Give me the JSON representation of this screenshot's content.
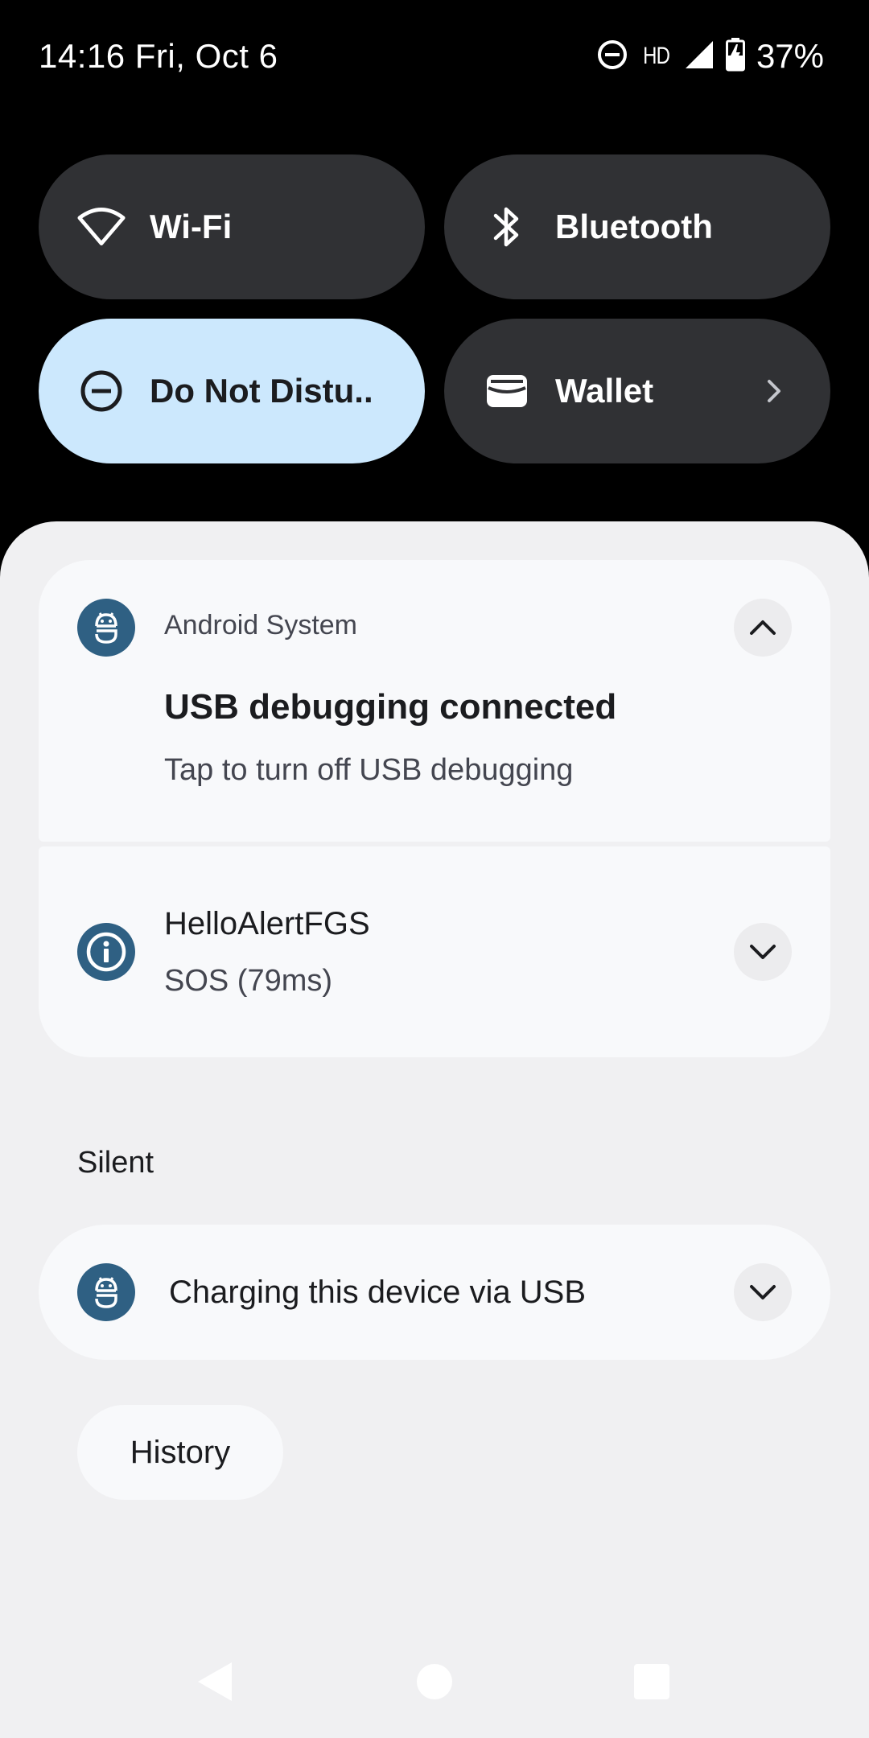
{
  "status_bar": {
    "time_date": "14:16 Fri, Oct 6",
    "network_label": "HD",
    "battery_percent": "37%",
    "icons": [
      "dnd-icon",
      "hd-icon",
      "signal-icon",
      "battery-charging-icon"
    ]
  },
  "quick_tiles": [
    {
      "label": "Wi-Fi",
      "icon": "wifi-icon",
      "active": false
    },
    {
      "label": "Bluetooth",
      "icon": "bluetooth-icon",
      "active": false
    },
    {
      "label": "Do Not Distu..",
      "icon": "dnd-icon",
      "active": true
    },
    {
      "label": "Wallet",
      "icon": "wallet-icon",
      "active": false,
      "has_chevron": true
    }
  ],
  "notifications": [
    {
      "app": "Android System",
      "title": "USB debugging connected",
      "text": "Tap to turn off USB debugging",
      "icon": "android-icon",
      "expanded": true
    },
    {
      "title": "HelloAlertFGS",
      "text": "SOS (79ms)",
      "icon": "info-icon",
      "expanded": false
    }
  ],
  "silent_section": {
    "label": "Silent",
    "notifications": [
      {
        "title": "Charging this device via USB",
        "icon": "android-icon",
        "expanded": false
      }
    ]
  },
  "history_label": "History",
  "colors": {
    "tile_bg": "#303134",
    "tile_active_bg": "#cce8fd",
    "shade_bg": "#f0f0f2",
    "card_bg": "#f8f9fb",
    "app_icon_bg": "#2f6083"
  },
  "nav_bar": {
    "icons": [
      "back-icon",
      "home-icon",
      "recents-icon"
    ]
  }
}
